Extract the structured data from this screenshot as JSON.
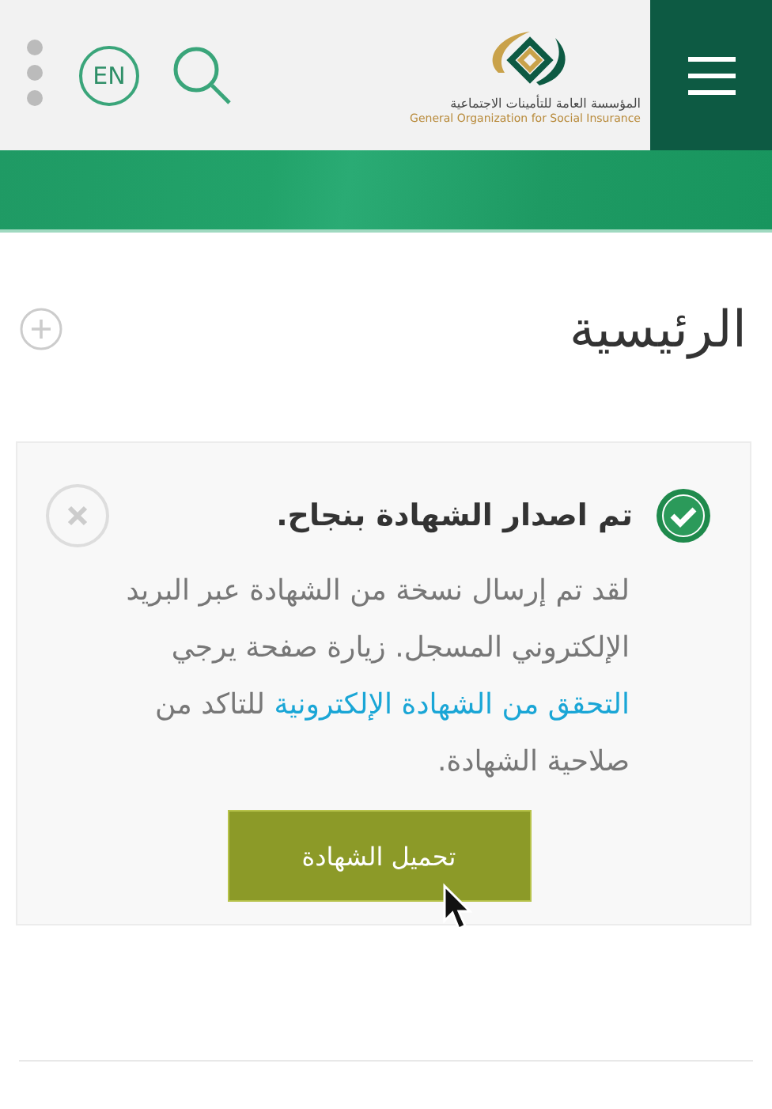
{
  "header": {
    "logo_arabic": "المؤسسة العامة للتأمينات الاجتماعية",
    "logo_english": "General Organization for Social Insurance",
    "language": "EN"
  },
  "page_title": "الرئيسية",
  "alert": {
    "title": "تم اصدار الشهادة بنجاح.",
    "text_before": "لقد تم إرسال نسخة من الشهادة عبر البريد الإلكتروني المسجل. زيارة صفحة يرجي",
    "link": "التحقق من الشهادة الإلكترونية",
    "text_after": "للتاكد من صلاحية الشهادة.",
    "button": "تحميل الشهادة"
  }
}
